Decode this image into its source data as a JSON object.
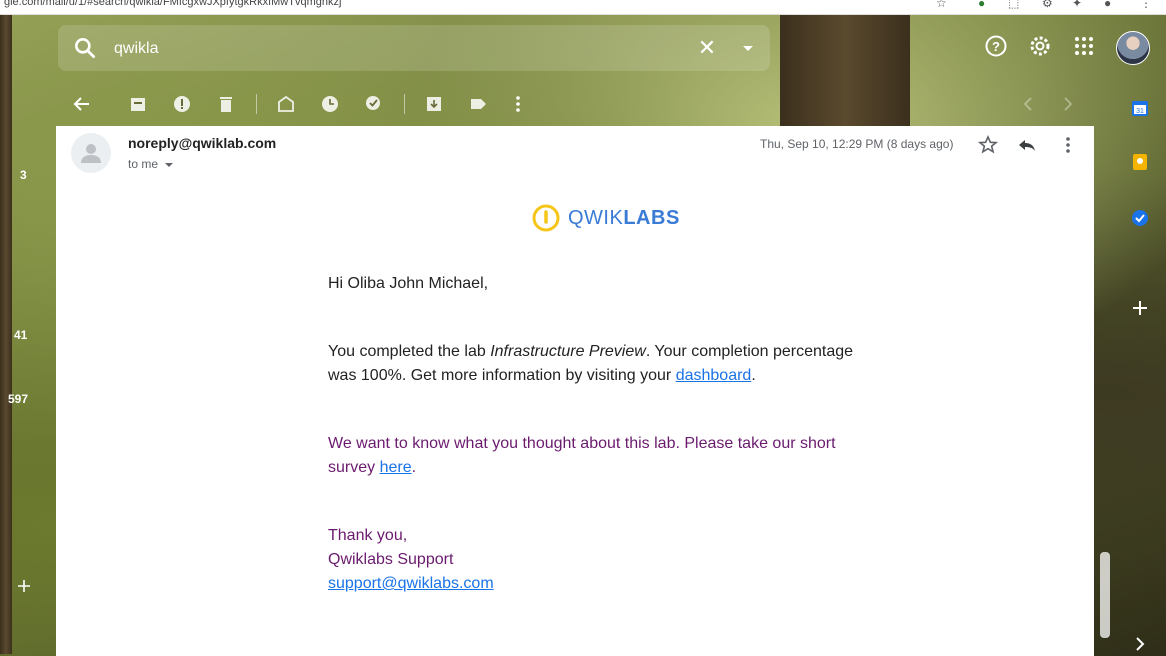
{
  "browser": {
    "url": "gle.com/mail/u/1/#search/qwikla/FMfcgxwJXpfytgkRkxfMwTvqmgnkzj"
  },
  "search": {
    "value": "qwikla"
  },
  "left_counts": [
    "3",
    "41",
    "597"
  ],
  "email": {
    "sender": "noreply@qwiklab.com",
    "to": "to me",
    "date": "Thu, Sep 10, 12:29 PM (8 days ago)",
    "logo_text_light": "QWIK",
    "logo_text_bold": "LABS",
    "greeting": "Hi Oliba John Michael,",
    "para1_pre": "You completed the lab ",
    "para1_lab": "Infrastructure Preview",
    "para1_mid": ". Your completion percentage was 100%. Get more information by visiting your ",
    "para1_link": "dashboard",
    "para1_end": ".",
    "para2_pre": "We want to know what you thought about this lab. Please take our short survey ",
    "para2_link": "here",
    "para2_end": ".",
    "thanks": "Thank you,",
    "team": "Qwiklabs Support",
    "support_email": "support@qwiklabs.com"
  },
  "right_panel": {
    "calendar_day": "31"
  },
  "colors": {
    "link": "#1a73e8",
    "purple_text": "#6a1b6e",
    "logo_blue": "#3a7bd5",
    "logo_yellow": "#f5c518"
  }
}
